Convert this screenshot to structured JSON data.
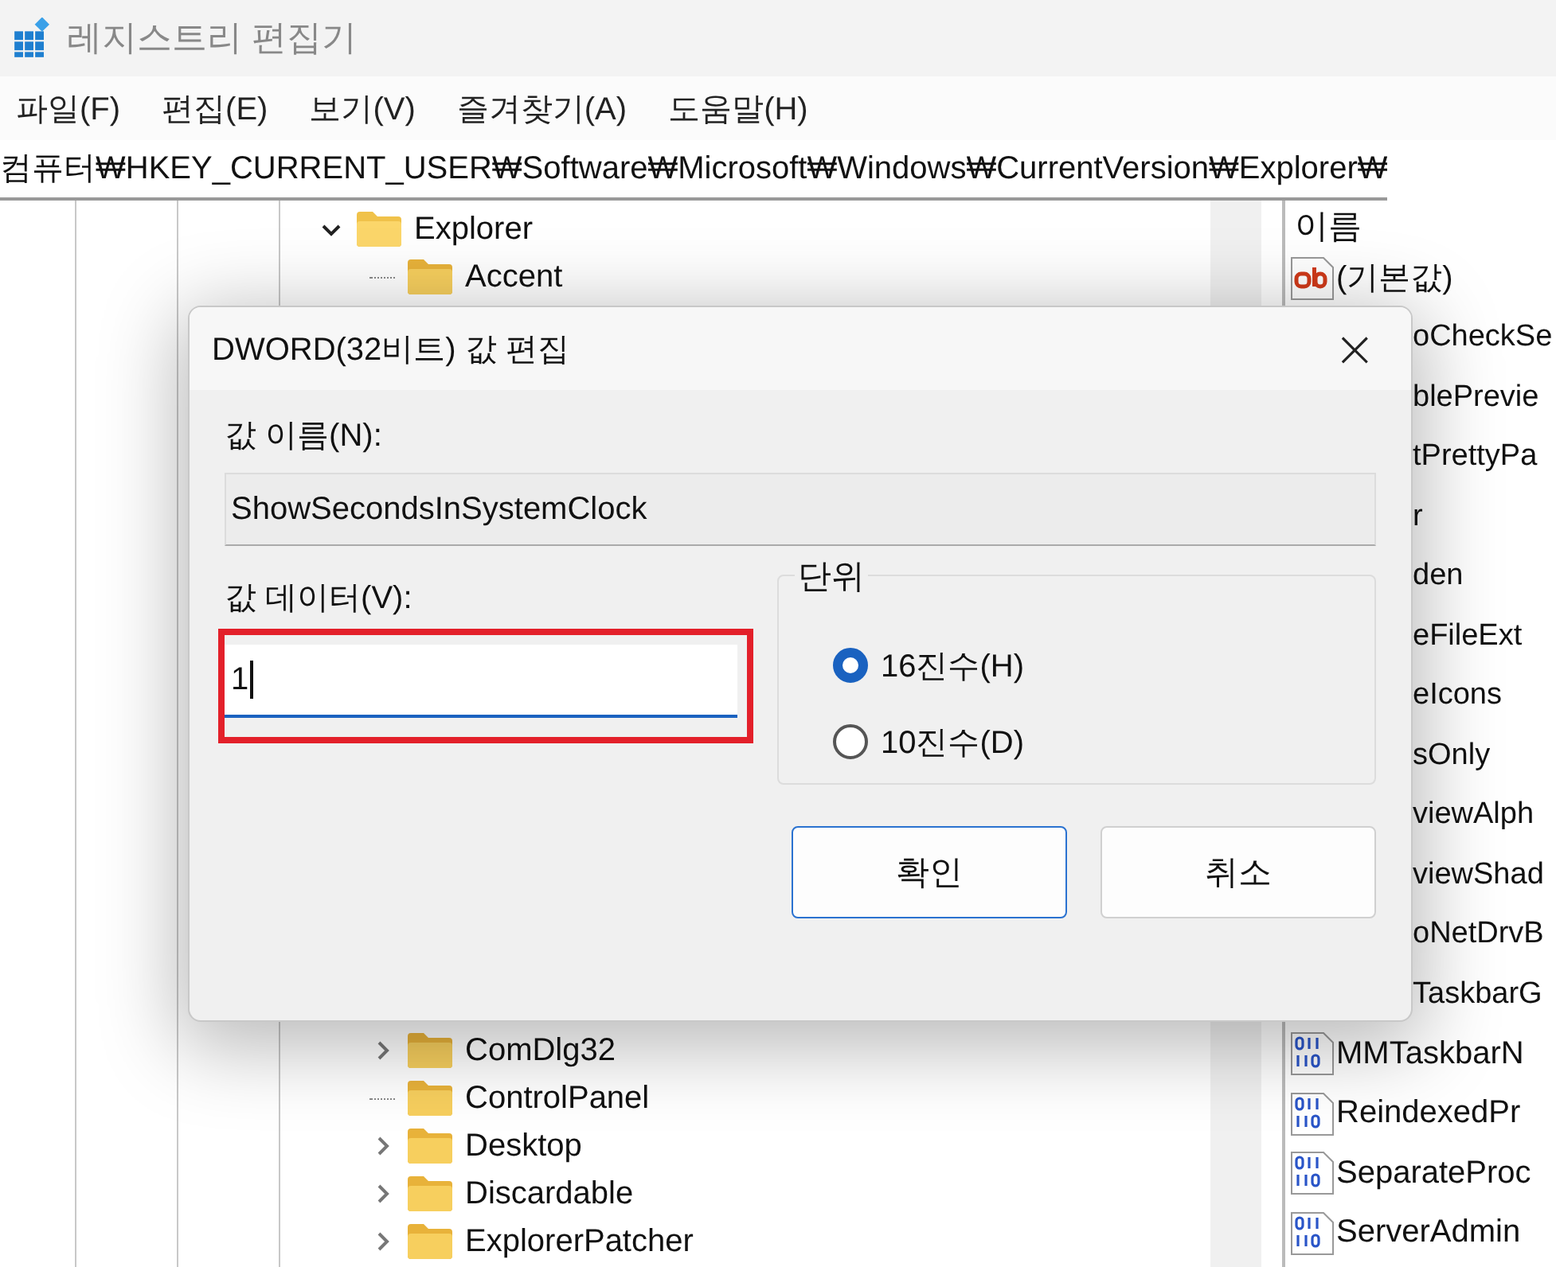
{
  "window": {
    "title": "레지스트리 편집기"
  },
  "menu": [
    "파일(F)",
    "편집(E)",
    "보기(V)",
    "즐겨찾기(A)",
    "도움말(H)"
  ],
  "address": "컴퓨터₩HKEY_CURRENT_USER₩Software₩Microsoft₩Windows₩CurrentVersion₩Explorer₩",
  "tree": [
    {
      "label": "Explorer",
      "expanded": true,
      "children": [
        {
          "label": "Accent"
        },
        {
          "label": "ComDlg32",
          "expanded": false
        },
        {
          "label": "ControlPanel"
        },
        {
          "label": "Desktop",
          "expanded": false
        },
        {
          "label": "Discardable",
          "expanded": false
        },
        {
          "label": "ExplorerPatcher",
          "expanded": false
        }
      ]
    }
  ],
  "list": {
    "column": "이름",
    "rows": [
      {
        "name": "(기본값)",
        "kind": "string"
      },
      {
        "name": "oCheckSe"
      },
      {
        "name": "blePrevie"
      },
      {
        "name": "tPrettyPa"
      },
      {
        "name": "r"
      },
      {
        "name": "den"
      },
      {
        "name": "eFileExt"
      },
      {
        "name": "eIcons"
      },
      {
        "name": "sOnly"
      },
      {
        "name": "viewAlph"
      },
      {
        "name": "viewShad"
      },
      {
        "name": "oNetDrvB"
      },
      {
        "name": "TaskbarG"
      },
      {
        "name": "MMTaskbarN",
        "kind": "dword"
      },
      {
        "name": "ReindexedPr",
        "kind": "dword"
      },
      {
        "name": "SeparateProc",
        "kind": "dword"
      },
      {
        "name": "ServerAdmin",
        "kind": "dword"
      }
    ]
  },
  "dialog": {
    "title": "DWORD(32비트) 값 편집",
    "close": "×",
    "name_label": "값 이름(N):",
    "name_value": "ShowSecondsInSystemClock",
    "data_label": "값 데이터(V):",
    "data_value": "1",
    "highlighted": true,
    "base_label": "단위",
    "bases": [
      {
        "label": "16진수(H)",
        "selected": true
      },
      {
        "label": "10진수(D)",
        "selected": false
      }
    ],
    "buttons": [
      {
        "label": "확인",
        "default": true
      },
      {
        "label": "취소",
        "default": false
      }
    ]
  }
}
